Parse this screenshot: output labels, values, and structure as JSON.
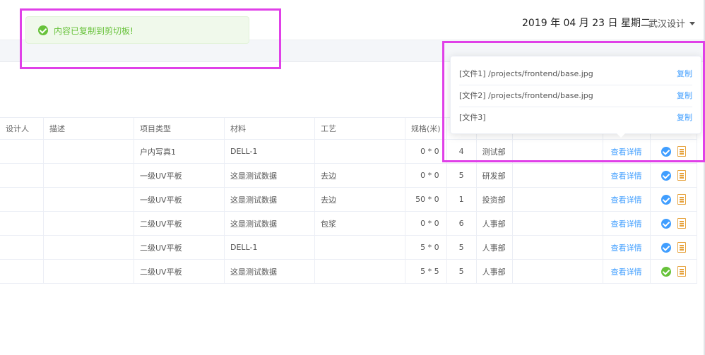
{
  "header": {
    "date": "2019 年 04 月 23 日 星期二",
    "user": "武汉设计"
  },
  "toast": {
    "message": "内容已复制到剪切板!",
    "icon": "success-check-icon",
    "color": "#67c23a"
  },
  "table": {
    "columns": [
      "设计人",
      "描述",
      "项目类型",
      "材料",
      "工艺",
      "规格(米)",
      "",
      "",
      "",
      "",
      ""
    ],
    "rows": [
      {
        "designer": "",
        "desc": "",
        "type": "户内写真1",
        "material": "DELL-1",
        "craft": "",
        "spec": "0 * 0",
        "qty": "4",
        "dept": "测试部",
        "note": "",
        "action": "查看详情",
        "status": "pending"
      },
      {
        "designer": "",
        "desc": "",
        "type": "一级UV平板",
        "material": "这是测试数据",
        "craft": "去边",
        "spec": "0 * 0",
        "qty": "5",
        "dept": "研发部",
        "note": "",
        "action": "查看详情",
        "status": "pending"
      },
      {
        "designer": "",
        "desc": "",
        "type": "一级UV平板",
        "material": "这是测试数据",
        "craft": "去边",
        "spec": "50 * 0",
        "qty": "1",
        "dept": "投资部",
        "note": "",
        "action": "查看详情",
        "status": "pending"
      },
      {
        "designer": "",
        "desc": "",
        "type": "二级UV平板",
        "material": "这是测试数据",
        "craft": "包浆",
        "spec": "0 * 0",
        "qty": "6",
        "dept": "人事部",
        "note": "",
        "action": "查看详情",
        "status": "pending"
      },
      {
        "designer": "",
        "desc": "",
        "type": "二级UV平板",
        "material": "DELL-1",
        "craft": "",
        "spec": "5 * 0",
        "qty": "5",
        "dept": "人事部",
        "note": "",
        "action": "查看详情",
        "status": "pending"
      },
      {
        "designer": "",
        "desc": "",
        "type": "二级UV平板",
        "material": "这是测试数据",
        "craft": "",
        "spec": "5 * 5",
        "qty": "5",
        "dept": "人事部",
        "note": "",
        "action": "查看详情",
        "status": "done"
      }
    ]
  },
  "popover": {
    "files": [
      {
        "label": "[文件1] /projects/frontend/base.jpg",
        "copy": "复制"
      },
      {
        "label": "[文件2] /projects/frontend/base.jpg",
        "copy": "复制"
      },
      {
        "label": "[文件3]",
        "copy": "复制"
      }
    ]
  },
  "colors": {
    "accent": "#409eff",
    "success": "#67c23a",
    "doc": "#e6a23c",
    "highlight": "#e040e8"
  }
}
